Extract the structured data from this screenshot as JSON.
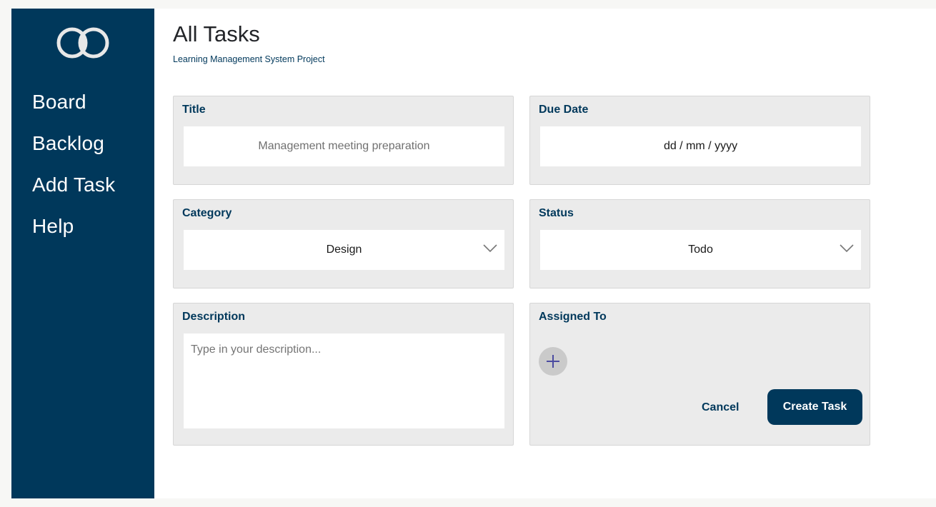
{
  "sidebar": {
    "logo_icon": "overlapping-circles-logo",
    "items": [
      {
        "label": "Board"
      },
      {
        "label": "Backlog"
      },
      {
        "label": "Add Task"
      },
      {
        "label": "Help"
      }
    ]
  },
  "header": {
    "title": "All Tasks",
    "subtitle": "Learning Management System Project"
  },
  "form": {
    "title": {
      "label": "Title",
      "placeholder": "Management meeting preparation"
    },
    "due_date": {
      "label": "Due Date",
      "placeholder": "dd / mm / yyyy"
    },
    "category": {
      "label": "Category",
      "value": "Design",
      "icon": "chevron-down-icon"
    },
    "status": {
      "label": "Status",
      "value": "Todo",
      "icon": "chevron-down-icon"
    },
    "description": {
      "label": "Description",
      "placeholder": "Type in your description..."
    },
    "assigned_to": {
      "label": "Assigned To",
      "icon": "plus-icon"
    },
    "cancel_label": "Cancel",
    "create_label": "Create Task"
  },
  "colors": {
    "primary": "#00385b",
    "card_bg": "#ebebeb",
    "add_button_bg": "#cacaca",
    "plus_icon": "#4b4ba0"
  }
}
